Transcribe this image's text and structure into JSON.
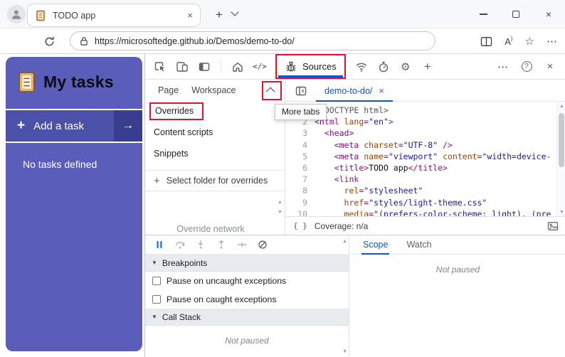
{
  "browser": {
    "tab_title": "TODO app",
    "url": "https://microsoftedge.github.io/Demos/demo-to-do/"
  },
  "glyphs": {
    "plus": "+",
    "close": "×",
    "more_h": "⋯",
    "more_v": "⋮",
    "help": "?",
    "braces": "{ }",
    "code": "</>",
    "gear": "⚙",
    "star": "☆",
    "read_aloud": "A",
    "read_aloud_paren": ")",
    "arrow_right": "→",
    "section_arrow": "▼",
    "scroll_up": "▲",
    "scroll_down": "▼"
  },
  "page": {
    "title": "My tasks",
    "add_task_label": "Add a task",
    "empty_message": "No tasks defined"
  },
  "devtools": {
    "sources_label": "Sources",
    "tooltip": "More tabs",
    "annotations": [
      "sources-tab",
      "more-tabs-button",
      "overrides-item"
    ],
    "navigator": {
      "tabs": [
        "Page",
        "Workspace"
      ],
      "items": [
        "Overrides",
        "Content scripts",
        "Snippets"
      ],
      "select_folder_label": "Select folder for overrides",
      "clipped_text": "Override network"
    },
    "editor": {
      "tab_label": "demo-to-do/",
      "status_coverage": "Coverage: n/a",
      "code_lines": [
        {
          "n": 1,
          "t": [
            [
              "m",
              "<!DOCTYPE html>"
            ]
          ]
        },
        {
          "n": 2,
          "t": [
            [
              "t",
              "<html "
            ],
            [
              "a",
              "lang"
            ],
            [
              "t",
              "="
            ],
            [
              "v",
              "\"en\""
            ],
            [
              "t",
              ">"
            ]
          ]
        },
        {
          "n": 3,
          "t": [
            [
              "x",
              "  "
            ],
            [
              "t",
              "<head>"
            ]
          ]
        },
        {
          "n": 4,
          "t": [
            [
              "x",
              "    "
            ],
            [
              "t",
              "<meta "
            ],
            [
              "a",
              "charset"
            ],
            [
              "t",
              "="
            ],
            [
              "v",
              "\"UTF-8\""
            ],
            [
              "t",
              " />"
            ]
          ]
        },
        {
          "n": 5,
          "t": [
            [
              "x",
              "    "
            ],
            [
              "t",
              "<meta "
            ],
            [
              "a",
              "name"
            ],
            [
              "t",
              "="
            ],
            [
              "v",
              "\"viewport\""
            ],
            [
              "t",
              " "
            ],
            [
              "a",
              "content"
            ],
            [
              "t",
              "="
            ],
            [
              "v",
              "\"width=device-"
            ]
          ]
        },
        {
          "n": 6,
          "t": [
            [
              "x",
              "    "
            ],
            [
              "t",
              "<title>"
            ],
            [
              "x",
              "TODO app"
            ],
            [
              "t",
              "</title>"
            ]
          ]
        },
        {
          "n": 7,
          "t": [
            [
              "x",
              "    "
            ],
            [
              "t",
              "<link"
            ]
          ]
        },
        {
          "n": 8,
          "t": [
            [
              "x",
              "      "
            ],
            [
              "a",
              "rel"
            ],
            [
              "t",
              "="
            ],
            [
              "v",
              "\"stylesheet\""
            ]
          ]
        },
        {
          "n": 9,
          "t": [
            [
              "x",
              "      "
            ],
            [
              "a",
              "href"
            ],
            [
              "t",
              "="
            ],
            [
              "v",
              "\"styles/light-theme.css\""
            ]
          ]
        },
        {
          "n": 10,
          "t": [
            [
              "x",
              "      "
            ],
            [
              "a",
              "media"
            ],
            [
              "t",
              "="
            ],
            [
              "v",
              "\"(prefers-color-scheme: light), (pre"
            ]
          ]
        }
      ]
    },
    "debugger": {
      "sections": [
        "Breakpoints",
        "Call Stack"
      ],
      "checkboxes": [
        "Pause on uncaught exceptions",
        "Pause on caught exceptions"
      ],
      "not_paused": "Not paused"
    },
    "scope_pane": {
      "tabs": [
        "Scope",
        "Watch"
      ],
      "not_paused": "Not paused"
    }
  },
  "colors": {
    "accent_blue": "#0b57d0",
    "annotation_red": "#e8112e",
    "panel_blue": "#5a5eb9",
    "button_blue": "#4b50a8",
    "arrow_box_blue": "#383d8f",
    "code_tag": "#881280",
    "code_attr_name": "#994500",
    "code_attr_value": "#1a1aa6"
  }
}
